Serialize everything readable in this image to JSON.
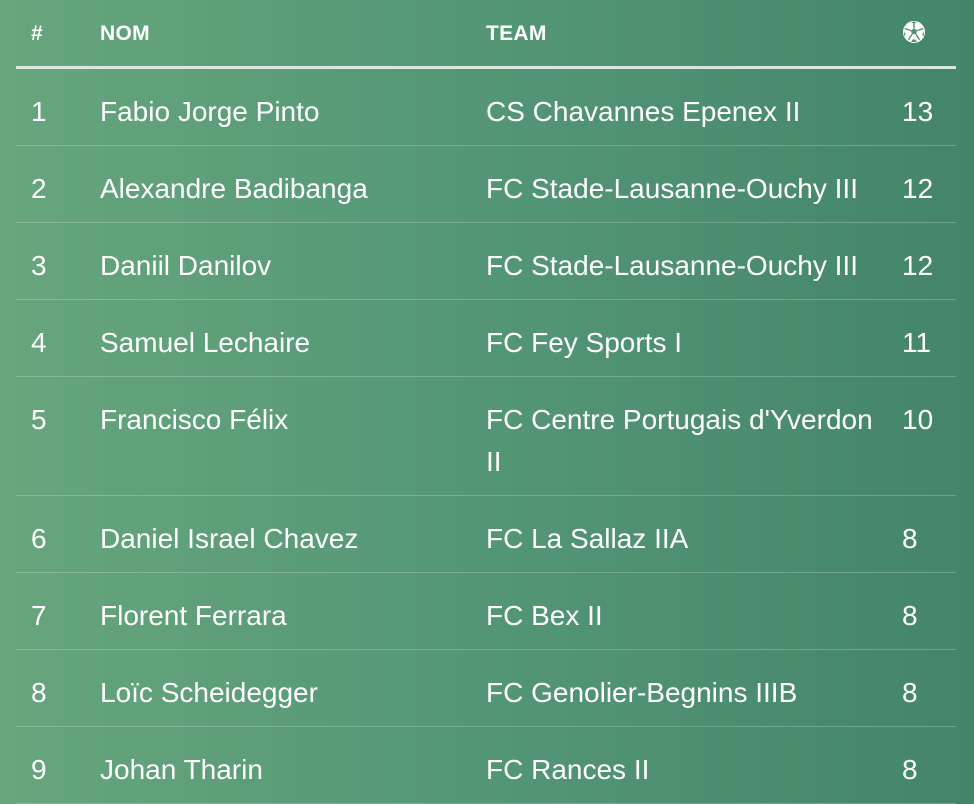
{
  "table": {
    "columns": {
      "rank": "#",
      "name": "NOM",
      "team": "TEAM",
      "goals_icon": "soccer-ball-icon"
    },
    "rows": [
      {
        "rank": "1",
        "name": "Fabio Jorge Pinto",
        "team": "CS Chavannes Epenex II",
        "goals": "13"
      },
      {
        "rank": "2",
        "name": "Alexandre Badibanga",
        "team": "FC Stade-Lausanne-Ouchy III",
        "goals": "12"
      },
      {
        "rank": "3",
        "name": "Daniil Danilov",
        "team": "FC Stade-Lausanne-Ouchy III",
        "goals": "12"
      },
      {
        "rank": "4",
        "name": "Samuel Lechaire",
        "team": "FC Fey Sports I",
        "goals": "11"
      },
      {
        "rank": "5",
        "name": "Francisco Félix",
        "team": "FC Centre Portugais d'Yverdon II",
        "goals": "10"
      },
      {
        "rank": "6",
        "name": "Daniel Israel Chavez",
        "team": "FC La Sallaz IIA",
        "goals": "8"
      },
      {
        "rank": "7",
        "name": "Florent Ferrara",
        "team": "FC Bex II",
        "goals": "8"
      },
      {
        "rank": "8",
        "name": "Loïc Scheidegger",
        "team": "FC Genolier-Begnins IIIB",
        "goals": "8"
      },
      {
        "rank": "9",
        "name": "Johan Tharin",
        "team": "FC Rances II",
        "goals": "8"
      }
    ]
  },
  "colors": {
    "background_left": "#67a67d",
    "background_right": "#448568",
    "text": "#ffffff"
  }
}
